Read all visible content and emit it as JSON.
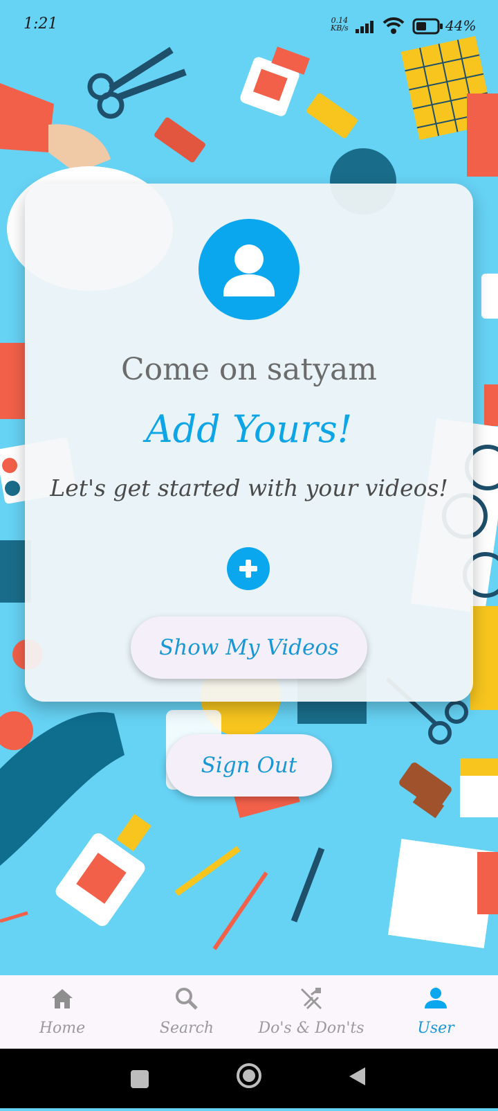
{
  "status_bar": {
    "time": "1:21",
    "net_speed_value": "0.14",
    "net_speed_unit": "KB/s",
    "battery": "44%"
  },
  "card": {
    "greeting": "Come on satyam",
    "headline": "Add Yours!",
    "subtitle": "Let's get started with your videos!",
    "show_videos_label": "Show My Videos"
  },
  "sign_out_label": "Sign Out",
  "bottom_nav": [
    {
      "label": "Home",
      "icon": "home-icon"
    },
    {
      "label": "Search",
      "icon": "search-icon"
    },
    {
      "label": "Do's & Don'ts",
      "icon": "tools-off-icon"
    },
    {
      "label": "User",
      "icon": "user-icon"
    }
  ],
  "active_tab": "User",
  "colors": {
    "accent": "#0aa6ee",
    "background": "#66d2f4"
  }
}
